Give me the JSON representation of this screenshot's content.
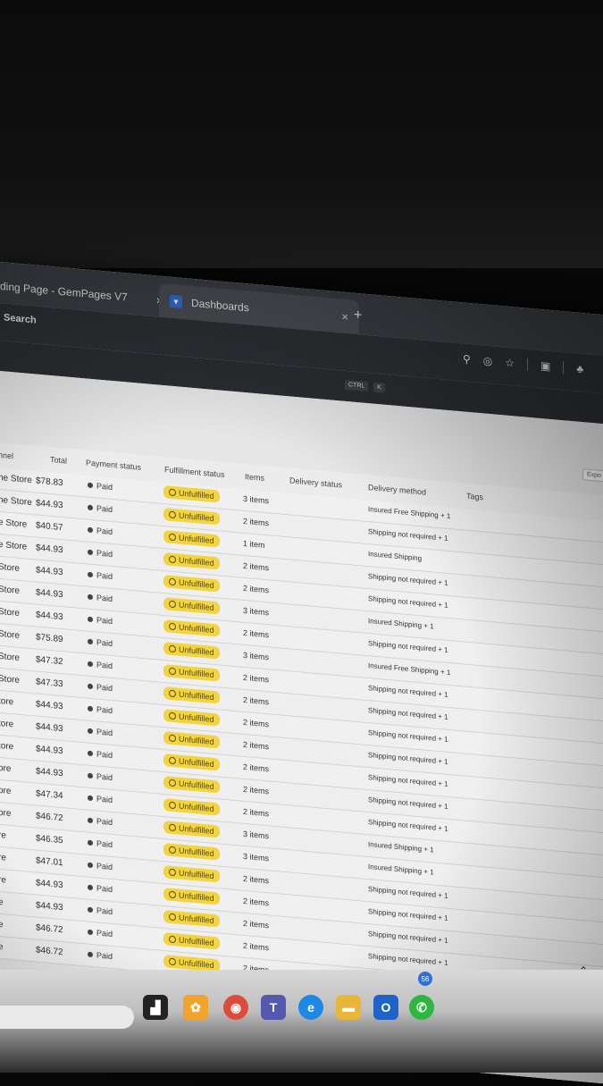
{
  "browser": {
    "tabs": [
      {
        "label": "ding Page - GemPages V7",
        "close": "×"
      },
      {
        "label": "Dashboards",
        "close": "×"
      }
    ],
    "new_tab": "+",
    "search_label": "Search",
    "shortcut": [
      "CTRL",
      "K"
    ]
  },
  "export_label": "Expo",
  "table": {
    "headers": {
      "channel": "nnel",
      "total": "Total",
      "payment": "Payment status",
      "fulfillment": "Fulfillment status",
      "items": "Items",
      "delivery_status": "Delivery status",
      "delivery_method": "Delivery method",
      "tags": "Tags"
    },
    "rows": [
      {
        "channel": "ne Store",
        "total": "$78.83",
        "payment": "Paid",
        "fulfillment": "Unfulfilled",
        "items": "3 items",
        "delivery": "Insured Free Shipping + 1"
      },
      {
        "channel": "ne Store",
        "total": "$44.93",
        "payment": "Paid",
        "fulfillment": "Unfulfilled",
        "items": "2 items",
        "delivery": "Shipping not required + 1"
      },
      {
        "channel": "e Store",
        "total": "$40.57",
        "payment": "Paid",
        "fulfillment": "Unfulfilled",
        "items": "1 item",
        "delivery": "Insured Shipping"
      },
      {
        "channel": "e Store",
        "total": "$44.93",
        "payment": "Paid",
        "fulfillment": "Unfulfilled",
        "items": "2 items",
        "delivery": "Shipping not required + 1"
      },
      {
        "channel": "Store",
        "total": "$44.93",
        "payment": "Paid",
        "fulfillment": "Unfulfilled",
        "items": "2 items",
        "delivery": "Shipping not required + 1"
      },
      {
        "channel": "Store",
        "total": "$44.93",
        "payment": "Paid",
        "fulfillment": "Unfulfilled",
        "items": "3 items",
        "delivery": "Insured Shipping + 1"
      },
      {
        "channel": "Store",
        "total": "$44.93",
        "payment": "Paid",
        "fulfillment": "Unfulfilled",
        "items": "2 items",
        "delivery": "Shipping not required + 1"
      },
      {
        "channel": "Store",
        "total": "$75.89",
        "payment": "Paid",
        "fulfillment": "Unfulfilled",
        "items": "3 items",
        "delivery": "Insured Free Shipping + 1"
      },
      {
        "channel": "Store",
        "total": "$47.32",
        "payment": "Paid",
        "fulfillment": "Unfulfilled",
        "items": "2 items",
        "delivery": "Shipping not required + 1"
      },
      {
        "channel": "Store",
        "total": "$47.33",
        "payment": "Paid",
        "fulfillment": "Unfulfilled",
        "items": "2 items",
        "delivery": "Shipping not required + 1"
      },
      {
        "channel": "tore",
        "total": "$44.93",
        "payment": "Paid",
        "fulfillment": "Unfulfilled",
        "items": "2 items",
        "delivery": "Shipping not required + 1"
      },
      {
        "channel": "tore",
        "total": "$44.93",
        "payment": "Paid",
        "fulfillment": "Unfulfilled",
        "items": "2 items",
        "delivery": "Shipping not required + 1"
      },
      {
        "channel": "tore",
        "total": "$44.93",
        "payment": "Paid",
        "fulfillment": "Unfulfilled",
        "items": "2 items",
        "delivery": "Shipping not required + 1"
      },
      {
        "channel": "ore",
        "total": "$44.93",
        "payment": "Paid",
        "fulfillment": "Unfulfilled",
        "items": "2 items",
        "delivery": "Shipping not required + 1"
      },
      {
        "channel": "ore",
        "total": "$47.34",
        "payment": "Paid",
        "fulfillment": "Unfulfilled",
        "items": "2 items",
        "delivery": "Shipping not required + 1"
      },
      {
        "channel": "ore",
        "total": "$46.72",
        "payment": "Paid",
        "fulfillment": "Unfulfilled",
        "items": "3 items",
        "delivery": "Insured Shipping + 1"
      },
      {
        "channel": "re",
        "total": "$46.35",
        "payment": "Paid",
        "fulfillment": "Unfulfilled",
        "items": "3 items",
        "delivery": "Insured Shipping + 1"
      },
      {
        "channel": "re",
        "total": "$47.01",
        "payment": "Paid",
        "fulfillment": "Unfulfilled",
        "items": "2 items",
        "delivery": "Shipping not required + 1"
      },
      {
        "channel": "re",
        "total": "$44.93",
        "payment": "Paid",
        "fulfillment": "Unfulfilled",
        "items": "2 items",
        "delivery": "Shipping not required + 1"
      },
      {
        "channel": "e",
        "total": "$44.93",
        "payment": "Paid",
        "fulfillment": "Unfulfilled",
        "items": "2 items",
        "delivery": "Shipping not required + 1"
      },
      {
        "channel": "e",
        "total": "$46.72",
        "payment": "Paid",
        "fulfillment": "Unfulfilled",
        "items": "2 items",
        "delivery": "Shipping not required + 1"
      },
      {
        "channel": "e",
        "total": "$46.72",
        "payment": "Paid",
        "fulfillment": "Unfulfilled",
        "items": "2 items",
        "delivery": "Shipping not required + 1"
      }
    ]
  },
  "taskbar": {
    "whatsapp_badge": "56"
  },
  "colors": {
    "unfulfilled_badge": "#f1d440",
    "browser_chrome": "#3b3f44"
  }
}
